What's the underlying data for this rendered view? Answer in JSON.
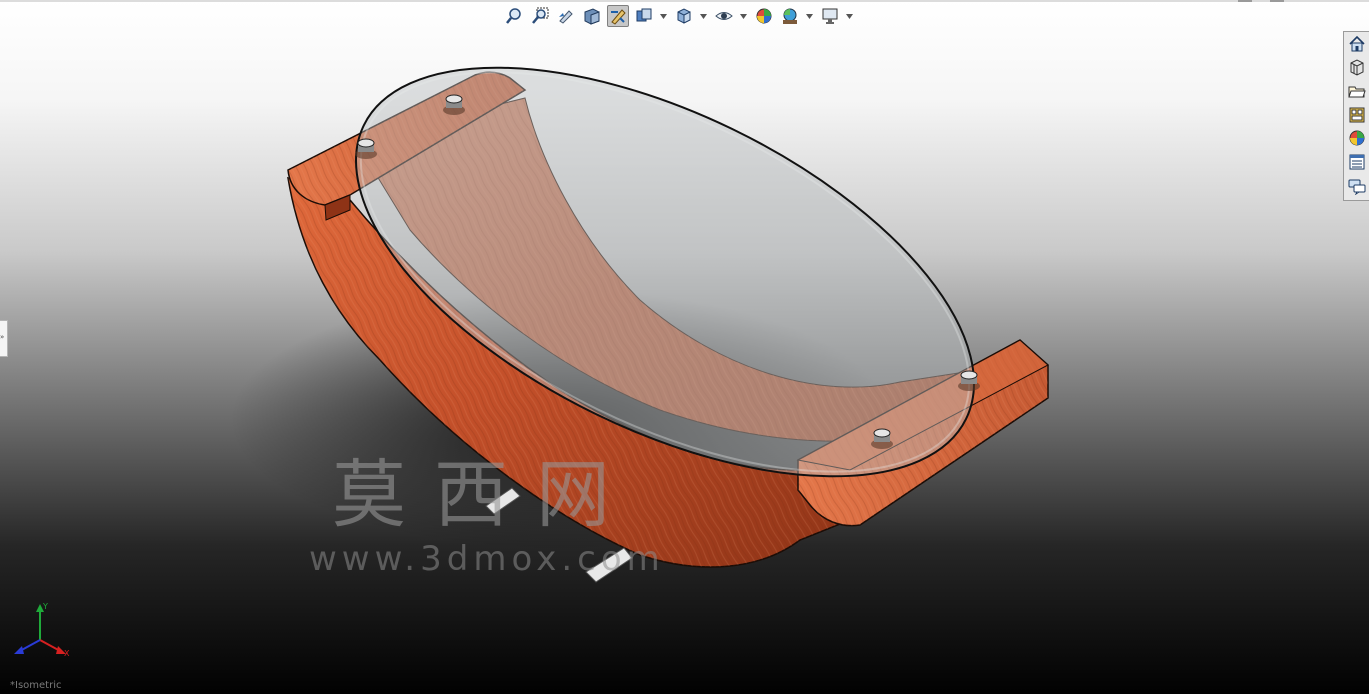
{
  "toolbar": {
    "buttons": [
      {
        "icon": "zoom-to-fit-icon"
      },
      {
        "icon": "zoom-to-area-icon"
      },
      {
        "icon": "previous-view-icon"
      },
      {
        "icon": "section-view-icon"
      },
      {
        "icon": "view-orientation-icon",
        "active": true
      },
      {
        "icon": "display-style-icon"
      },
      {
        "icon": "hide-show-items-icon"
      },
      {
        "icon": "edit-appearance-icon"
      },
      {
        "icon": "apply-scene-icon"
      },
      {
        "icon": "view-settings-icon"
      }
    ]
  },
  "taskpane": {
    "buttons": [
      {
        "icon": "solidworks-resources-icon"
      },
      {
        "icon": "design-library-icon"
      },
      {
        "icon": "file-explorer-icon"
      },
      {
        "icon": "view-palette-icon"
      },
      {
        "icon": "appearances-scenes-icon"
      },
      {
        "icon": "custom-properties-icon"
      },
      {
        "icon": "forum-icon"
      }
    ]
  },
  "watermark": {
    "chinese": "莫西网",
    "url": "www.3dmox.com"
  },
  "triad": {
    "x_label": "X",
    "y_label": "Y"
  },
  "view": {
    "name": "*Isometric"
  },
  "colors": {
    "wood": "#c8532c",
    "wood_dark": "#7e2a14",
    "glass": "#a9b1b2",
    "x_axis": "#d62020",
    "y_axis": "#1faa3a",
    "z_axis": "#2a3bd6"
  }
}
